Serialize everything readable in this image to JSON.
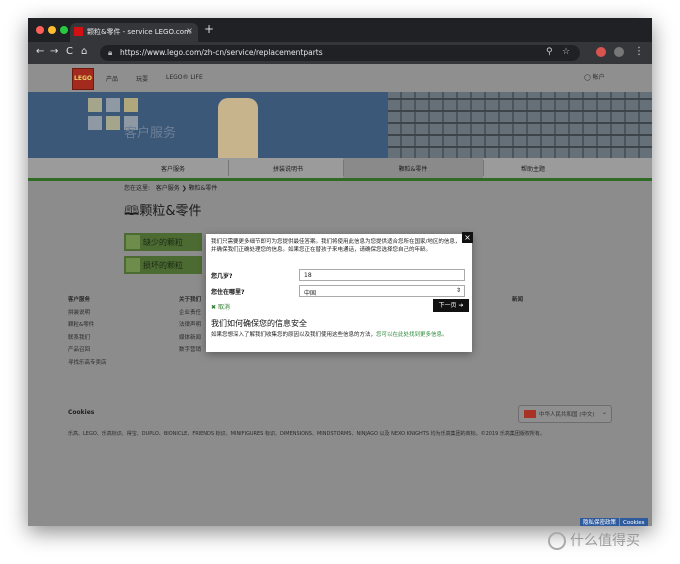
{
  "browser": {
    "tab_title": "颗粒&零件 - service LEGO.com",
    "tab_close": "×",
    "new_tab": "+",
    "url": "https://www.lego.com/zh-cn/service/replacementparts",
    "nav_back": "←",
    "nav_forward": "→",
    "nav_reload": "C",
    "nav_home": "⌂"
  },
  "site": {
    "logo_text": "LEGO",
    "nav_items": [
      "产品",
      "玩耍",
      "LEGO® LIFE"
    ],
    "account": "帐户",
    "hero_text": "客户服务",
    "subnav": [
      "客户服务",
      "拼装说明书",
      "颗粒&零件",
      "帮助主题"
    ],
    "breadcrumb": [
      "您在这里:",
      "客户服务",
      "颗粒&零件"
    ],
    "page_title": "颗粒&零件",
    "green_buttons": [
      "缺少的颗粒",
      "损坏的颗粒"
    ]
  },
  "footer": {
    "col1_title": "客户服务",
    "col1_items": [
      "拼装说明",
      "颗粒&零件",
      "联系我们",
      "产品召回",
      "寻找乐高专卖店"
    ],
    "col2_title": "关于我们",
    "col2_items": [
      "企业责任",
      "法律声明",
      "媒体新闻",
      "数字营销"
    ],
    "col3_title": "新闻",
    "cookies": "Cookies",
    "region": "中华人民共和国 (中文)",
    "legal_line": "乐高、LEGO、乐高标识、得宝、DUPLO、BIONICLE、FRIENDS 标识、MINIFIGURES 标识、DIMENSIONS、MINDSTORMS、NINJAGO 以及 NEXO KNIGHTS 均为乐高集团的商标。©2019 乐高集团版权所有。",
    "privacy_btn": "隐私保密政策",
    "cookies_btn": "Cookies"
  },
  "modal": {
    "close": "×",
    "intro": "我们只需要更多细节即可为您提供最佳答案。我们将使用此信息为您提供适合您所在国家/地区的信息，并确保我们正确处理您的信息。如果您正在替孩子来电通话，请确保您选择您自己的年龄。",
    "age_label": "您几岁?",
    "age_value": "18",
    "location_label": "您住在哪里?",
    "location_value": "中国",
    "cancel_label": "取消",
    "next_label": "下一页",
    "privacy_heading": "我们如何确保您的信息安全",
    "privacy_text": "如果您想深入了解我们收集您的原因以及我们使用这些信息的方法，",
    "privacy_link": "您可以在此处找到更多信息。"
  },
  "watermark": "什么值得买",
  "colors": {
    "lego_red": "#d01012",
    "lego_green": "#2f6b25",
    "link_green": "#2d8a3a",
    "privacy_blue": "#2f5b9c"
  }
}
